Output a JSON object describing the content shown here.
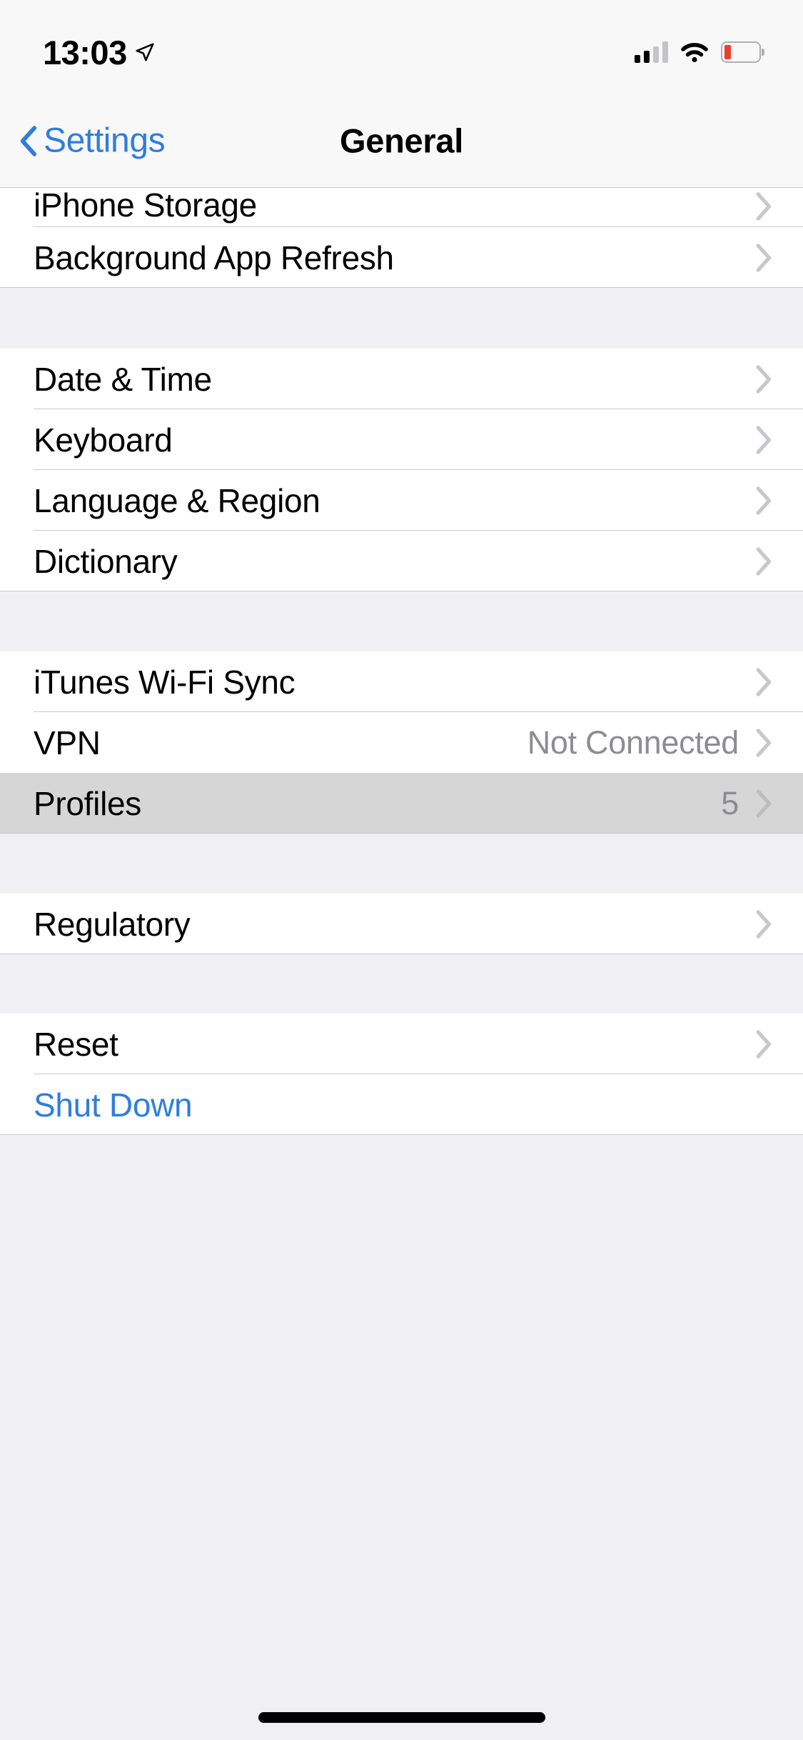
{
  "status_bar": {
    "time": "13:03",
    "location_icon": "location-arrow-icon",
    "cellular_icon": "cellular-signal-icon",
    "cellular_bars_filled": 2,
    "cellular_bars_total": 4,
    "wifi_icon": "wifi-icon",
    "battery_icon": "battery-low-icon",
    "battery_level_percent": 18,
    "battery_color": "#F03B2D"
  },
  "nav_bar": {
    "back_label": "Settings",
    "back_icon": "chevron-left-icon",
    "title": "General",
    "accent_color": "#2E7EDB"
  },
  "sections": [
    {
      "id": "storage",
      "rows": [
        {
          "label": "iPhone Storage",
          "value": "",
          "accessory": "chevron-right-icon"
        },
        {
          "label": "Background App Refresh",
          "value": "",
          "accessory": "chevron-right-icon"
        }
      ]
    },
    {
      "id": "localization",
      "rows": [
        {
          "label": "Date & Time",
          "value": "",
          "accessory": "chevron-right-icon"
        },
        {
          "label": "Keyboard",
          "value": "",
          "accessory": "chevron-right-icon"
        },
        {
          "label": "Language & Region",
          "value": "",
          "accessory": "chevron-right-icon"
        },
        {
          "label": "Dictionary",
          "value": "",
          "accessory": "chevron-right-icon"
        }
      ]
    },
    {
      "id": "connectivity",
      "rows": [
        {
          "label": "iTunes Wi-Fi Sync",
          "value": "",
          "accessory": "chevron-right-icon"
        },
        {
          "label": "VPN",
          "value": "Not Connected",
          "accessory": "chevron-right-icon"
        },
        {
          "label": "Profiles",
          "value": "5",
          "accessory": "chevron-right-icon",
          "highlighted": true
        }
      ]
    },
    {
      "id": "legal",
      "rows": [
        {
          "label": "Regulatory",
          "value": "",
          "accessory": "chevron-right-icon"
        }
      ]
    },
    {
      "id": "system",
      "rows": [
        {
          "label": "Reset",
          "value": "",
          "accessory": "chevron-right-icon"
        },
        {
          "label": "Shut Down",
          "value": "",
          "accessory": "none",
          "style": "link"
        }
      ]
    }
  ],
  "colors": {
    "page_background": "#EFEFF4",
    "row_background": "#FFFFFF",
    "separator": "#C9C9CC",
    "highlight": "#D6D6D6",
    "secondary_text": "#8C8C91",
    "chevron": "#C7C7CC",
    "accent": "#2E7EDB"
  },
  "home_indicator": "home-indicator"
}
